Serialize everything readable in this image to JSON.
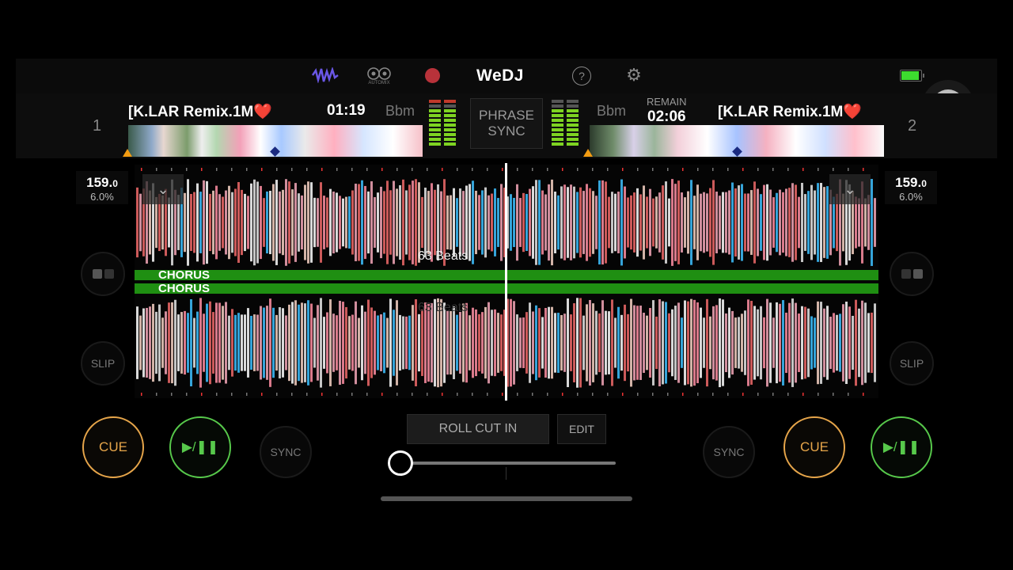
{
  "topbar": {
    "brand": "WeDJ",
    "automix_label": "AUTOMIX",
    "icons": [
      "waveform-icon",
      "automix-icon",
      "record-icon",
      "help-icon",
      "gear-icon",
      "battery-icon"
    ]
  },
  "colors": {
    "cue": "#e6a54a",
    "play": "#57c94b",
    "chorus": "#1f8f12",
    "meter": "#7ed322",
    "record": "#c0392b"
  },
  "deck1": {
    "number": "1",
    "title": "[K.LAR Remix.1M❤️",
    "time": "01:19",
    "key": "Bbm",
    "bpm_main": "159.",
    "bpm_decimal": "0",
    "pitch": "6.0%",
    "slip": "SLIP",
    "cue": "CUE",
    "play": "▶/❚❚",
    "sync": "SYNC"
  },
  "deck2": {
    "number": "2",
    "title": "[K.LAR Remix.1M❤️",
    "remain_label": "REMAIN",
    "time": "02:06",
    "key": "Bbm",
    "bpm_main": "159.",
    "bpm_decimal": "0",
    "pitch": "6.0%",
    "slip": "SLIP",
    "cue": "CUE",
    "play": "▶/❚❚",
    "sync": "SYNC"
  },
  "center": {
    "phrase_sync": "PHRASE\nSYNC",
    "phrase_line1": "PHRASE",
    "phrase_line2": "SYNC",
    "beats_top": "63 Beats",
    "beats_bottom": "63 Beats",
    "chorus_top": "CHORUS",
    "chorus_bottom": "CHORUS",
    "roll_cut_in": "ROLL CUT IN",
    "edit": "EDIT",
    "crossfader_value": 0
  }
}
